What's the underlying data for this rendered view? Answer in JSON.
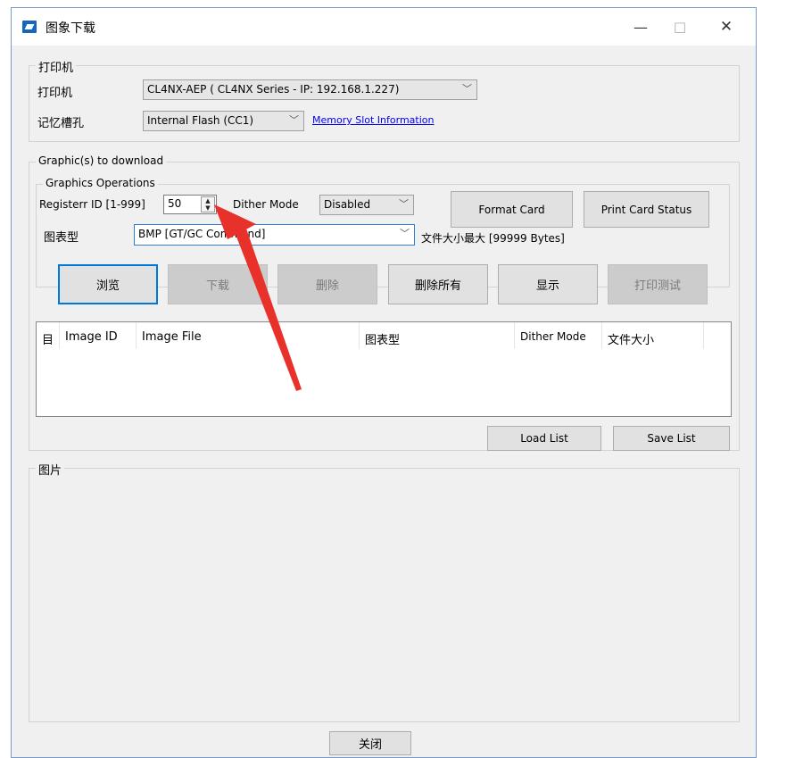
{
  "window": {
    "title": "图象下载",
    "minimize": "—",
    "maximize": "□",
    "close": "✕"
  },
  "printer_group": {
    "legend": "打印机",
    "printer_label": "打印机",
    "printer_value": "CL4NX-AEP ( CL4NX Series - IP: 192.168.1.227)",
    "slot_label": "记忆槽孔",
    "slot_value": "Internal Flash (CC1)",
    "slot_info_link": "Memory Slot Information"
  },
  "download_group": {
    "legend": "Graphic(s) to download",
    "ops_legend": "Graphics Operations",
    "register_label": "Registerr ID [1-999]",
    "register_value": "50",
    "dither_label": "Dither Mode",
    "dither_value": "Disabled",
    "format_card": "Format Card",
    "print_card_status": "Print Card Status",
    "type_label": "图表型",
    "type_value": "BMP [GT/GC Command]",
    "file_size_text": "文件大小最大 [99999 Bytes]",
    "buttons": {
      "browse": "浏览",
      "download": "下载",
      "delete": "删除",
      "delete_all": "删除所有",
      "show": "显示",
      "print_test": "打印测试"
    }
  },
  "table": {
    "columns": [
      "目",
      "Image ID",
      "Image File",
      "图表型",
      "Dither Mode",
      "文件大小"
    ]
  },
  "list_buttons": {
    "load": "Load List",
    "save": "Save List"
  },
  "image_group": {
    "legend": "图片"
  },
  "footer": {
    "close": "关闭"
  },
  "colors": {
    "annotation_arrow": "#e8312a",
    "accent": "#0078d7"
  }
}
